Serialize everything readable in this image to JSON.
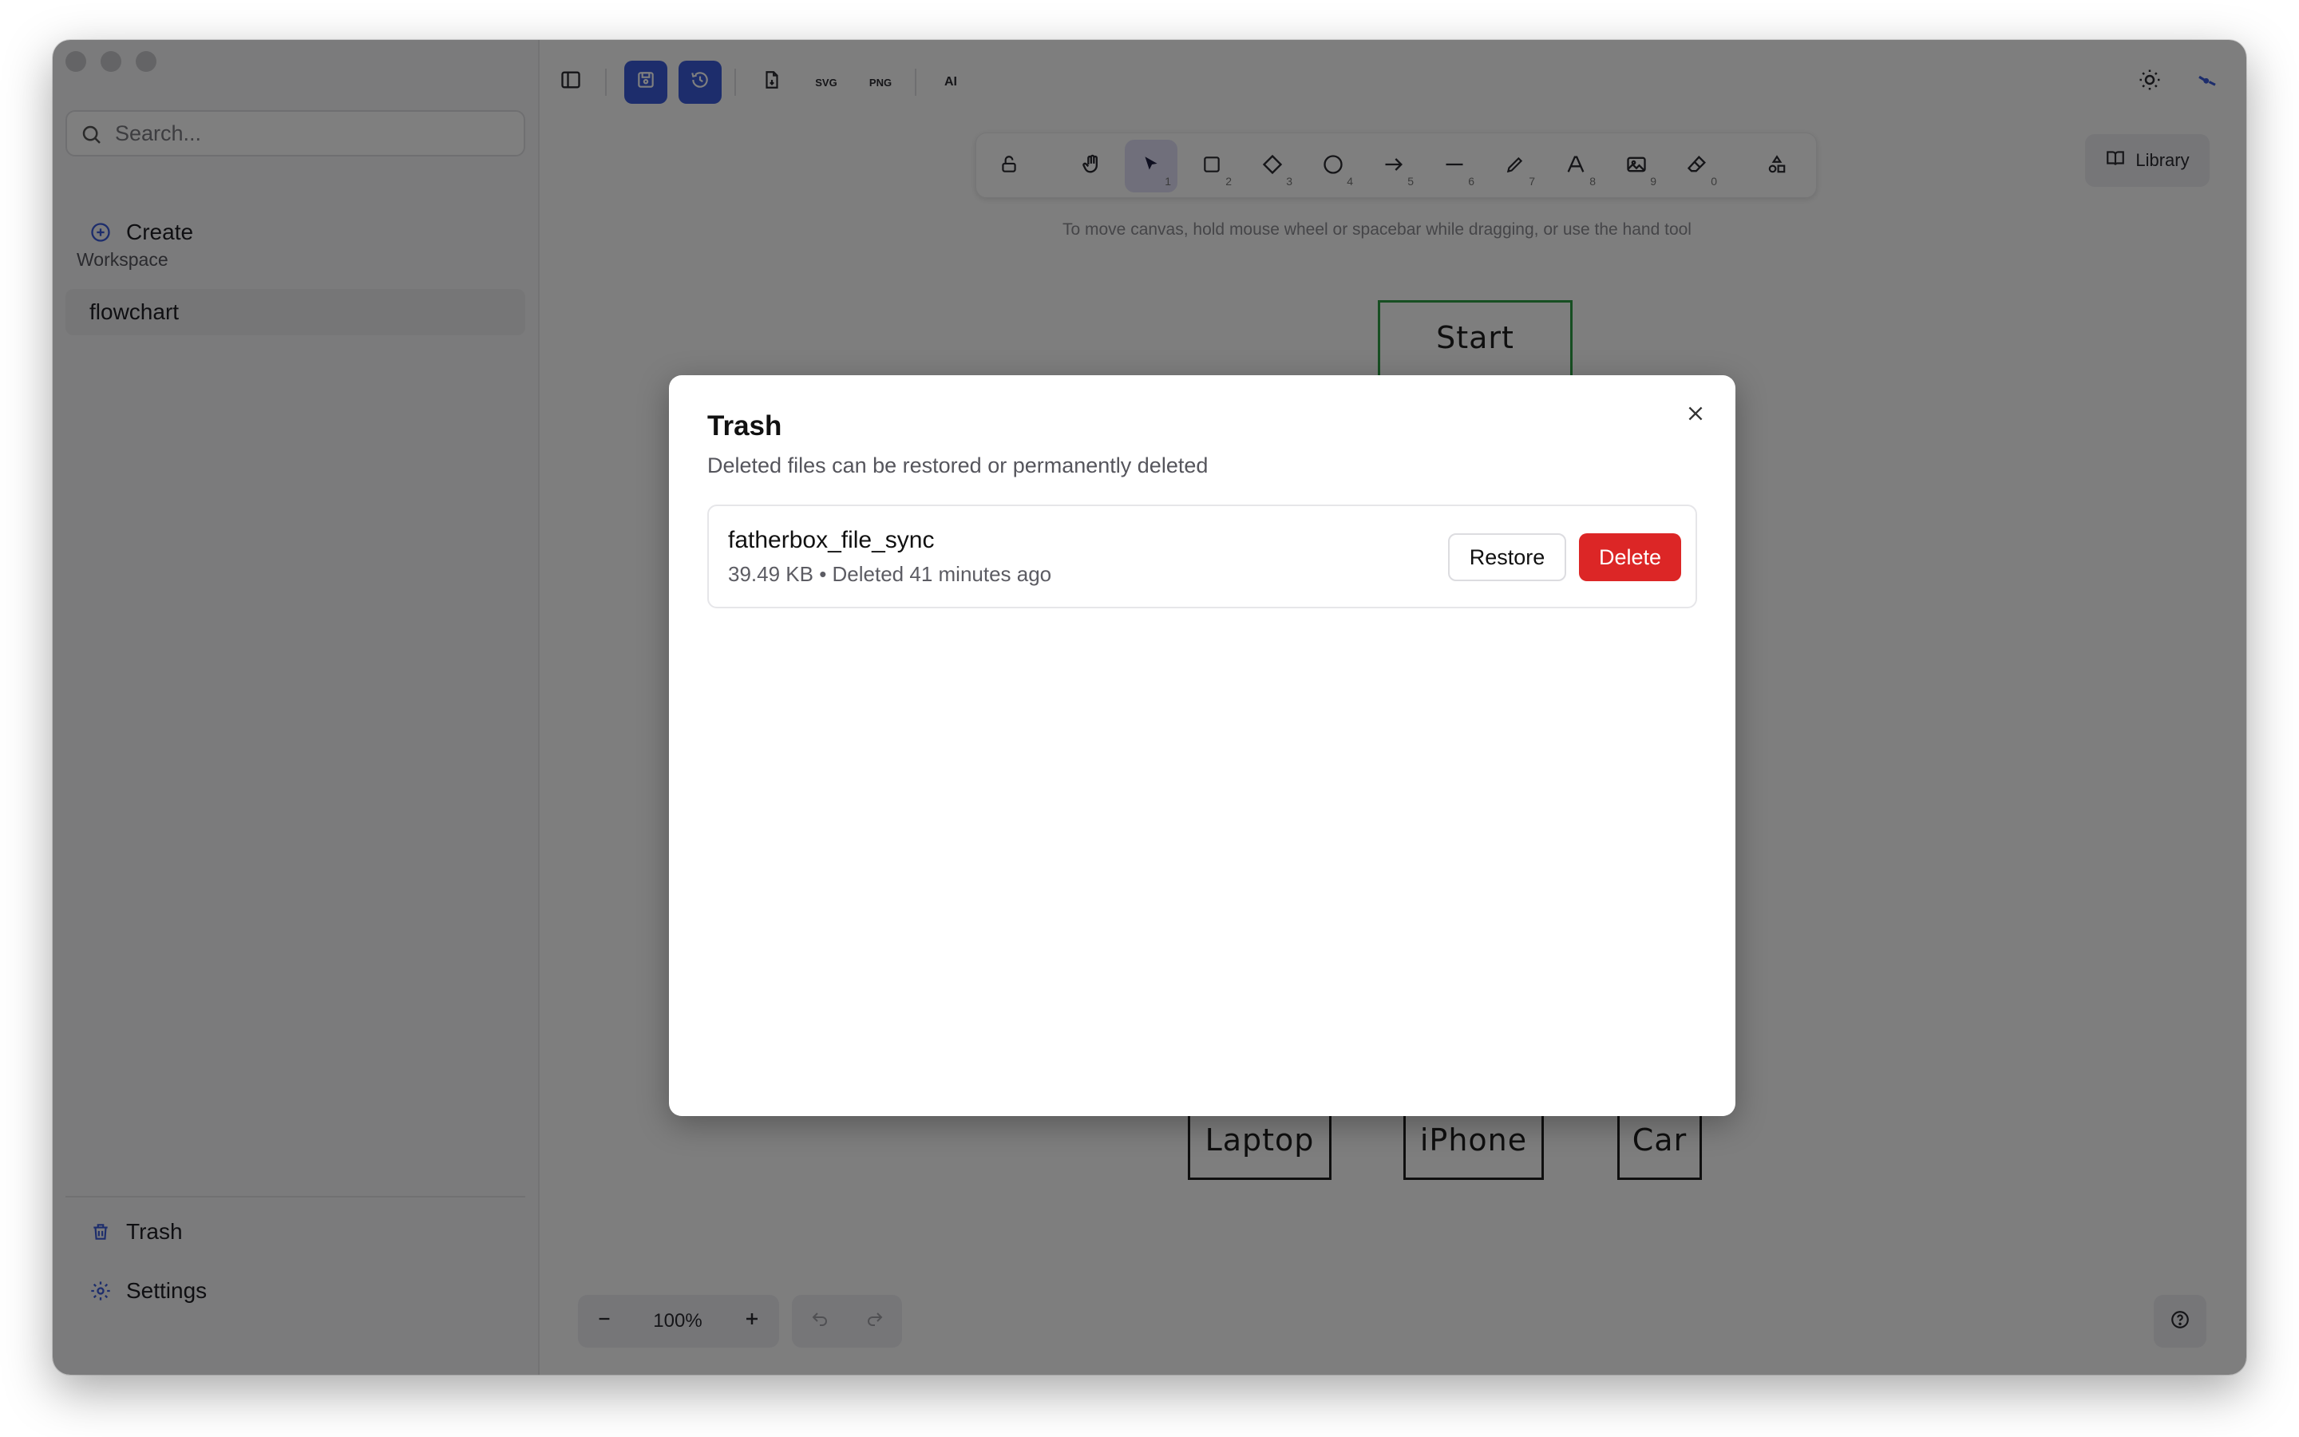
{
  "sidebar": {
    "search_placeholder": "Search...",
    "create_label": "Create",
    "workspace_label": "Workspace",
    "workspace_item": "flowchart",
    "trash_label": "Trash",
    "settings_label": "Settings"
  },
  "topbar": {
    "ai_label": "AI",
    "export_svg_label": "SVG",
    "export_png_label": "PNG"
  },
  "toolbar": {
    "tools": [
      {
        "name": "lock",
        "num": ""
      },
      {
        "name": "hand",
        "num": ""
      },
      {
        "name": "selection",
        "num": "1"
      },
      {
        "name": "rectangle",
        "num": "2"
      },
      {
        "name": "diamond",
        "num": "3"
      },
      {
        "name": "ellipse",
        "num": "4"
      },
      {
        "name": "arrow",
        "num": "5"
      },
      {
        "name": "line",
        "num": "6"
      },
      {
        "name": "draw",
        "num": "7"
      },
      {
        "name": "text",
        "num": "8"
      },
      {
        "name": "image",
        "num": "9"
      },
      {
        "name": "eraser",
        "num": "0"
      },
      {
        "name": "extra-tools",
        "num": ""
      }
    ],
    "hint": "To move canvas, hold mouse wheel or spacebar while dragging, or use the hand tool"
  },
  "library_label": "Library",
  "zoom_level": "100%",
  "canvas": {
    "nodes": [
      "Laptop",
      "iPhone",
      "Car"
    ],
    "top_node_partial": "Start"
  },
  "modal": {
    "title": "Trash",
    "description": "Deleted files can be restored or permanently deleted",
    "files": [
      {
        "name": "fatherbox_file_sync",
        "meta": "39.49 KB • Deleted 41 minutes ago",
        "restore_label": "Restore",
        "delete_label": "Delete"
      }
    ]
  },
  "colors": {
    "accent": "#3a5bd9",
    "danger": "#dc2626",
    "overlay": "rgba(0,0,0,0.5)"
  }
}
